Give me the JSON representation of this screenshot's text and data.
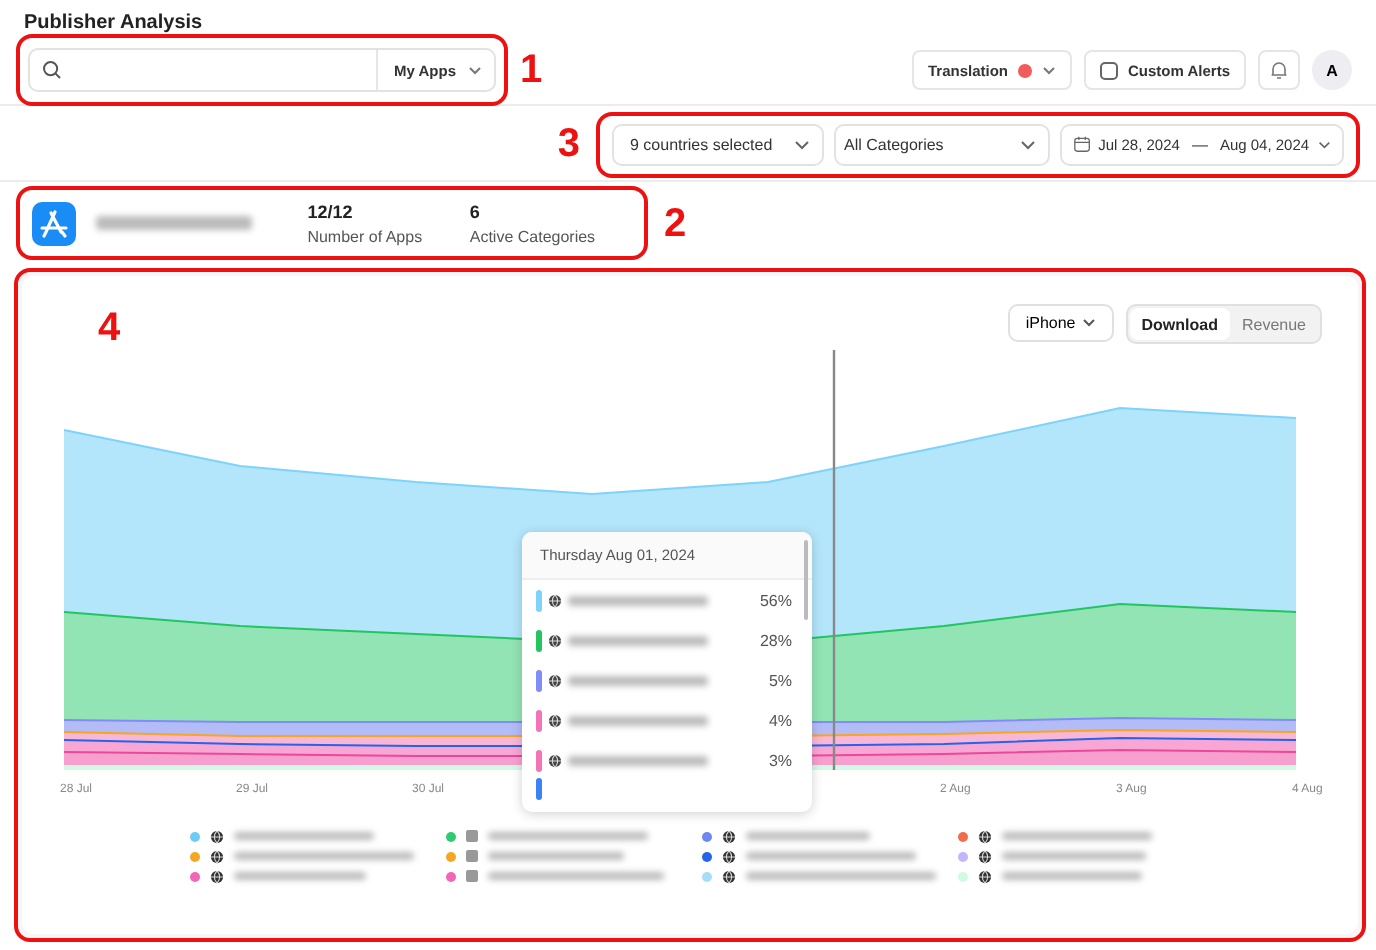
{
  "page": {
    "title": "Publisher Analysis"
  },
  "annotations": [
    "1",
    "3",
    "2",
    "4"
  ],
  "search": {
    "dropdown": "My Apps"
  },
  "toolbar": {
    "translation": {
      "label": "Translation",
      "on": true
    },
    "custom_alerts": "Custom Alerts",
    "avatar": "A"
  },
  "filters": {
    "countries": "9 countries selected",
    "category": "All Categories",
    "date_from": "Jul 28, 2024",
    "date_separator": "—",
    "date_to": "Aug 04, 2024"
  },
  "publisher": {
    "stats": [
      {
        "value": "12/12",
        "label": "Number of Apps"
      },
      {
        "value": "6",
        "label": "Active Categories"
      }
    ]
  },
  "chart": {
    "device": "iPhone",
    "metric_tabs": [
      {
        "label": "Download",
        "selected": true
      },
      {
        "label": "Revenue",
        "selected": false
      }
    ],
    "x_labels": [
      "28 Jul",
      "29 Jul",
      "30 Jul",
      "2 Aug",
      "3 Aug",
      "4 Aug"
    ],
    "tooltip": {
      "title": "Thursday Aug 01, 2024",
      "rows": [
        {
          "color": "#7dd3fc",
          "share": "56%"
        },
        {
          "color": "#22c55e",
          "share": "28%"
        },
        {
          "color": "#818cf8",
          "share": "5%"
        },
        {
          "color": "#f472b6",
          "share": "4%"
        },
        {
          "color": "#f472b6",
          "share": "3%"
        }
      ]
    },
    "legend": [
      {
        "color": "#6ecbf5",
        "kind": "globe"
      },
      {
        "color": "#2ecc71",
        "kind": "square"
      },
      {
        "color": "#6f87f0",
        "kind": "globe"
      },
      {
        "color": "#f26b4a",
        "kind": "globe"
      },
      {
        "color": "#f5a623",
        "kind": "globe"
      },
      {
        "color": "#f5a623",
        "kind": "square"
      },
      {
        "color": "#2563eb",
        "kind": "globe"
      },
      {
        "color": "#c4b5fd",
        "kind": "globe"
      },
      {
        "color": "#f266b8",
        "kind": "globe"
      },
      {
        "color": "#f266b8",
        "kind": "square"
      },
      {
        "color": "#a5dcf7",
        "kind": "globe"
      },
      {
        "color": "#d1fae5",
        "kind": "globe"
      }
    ]
  }
}
